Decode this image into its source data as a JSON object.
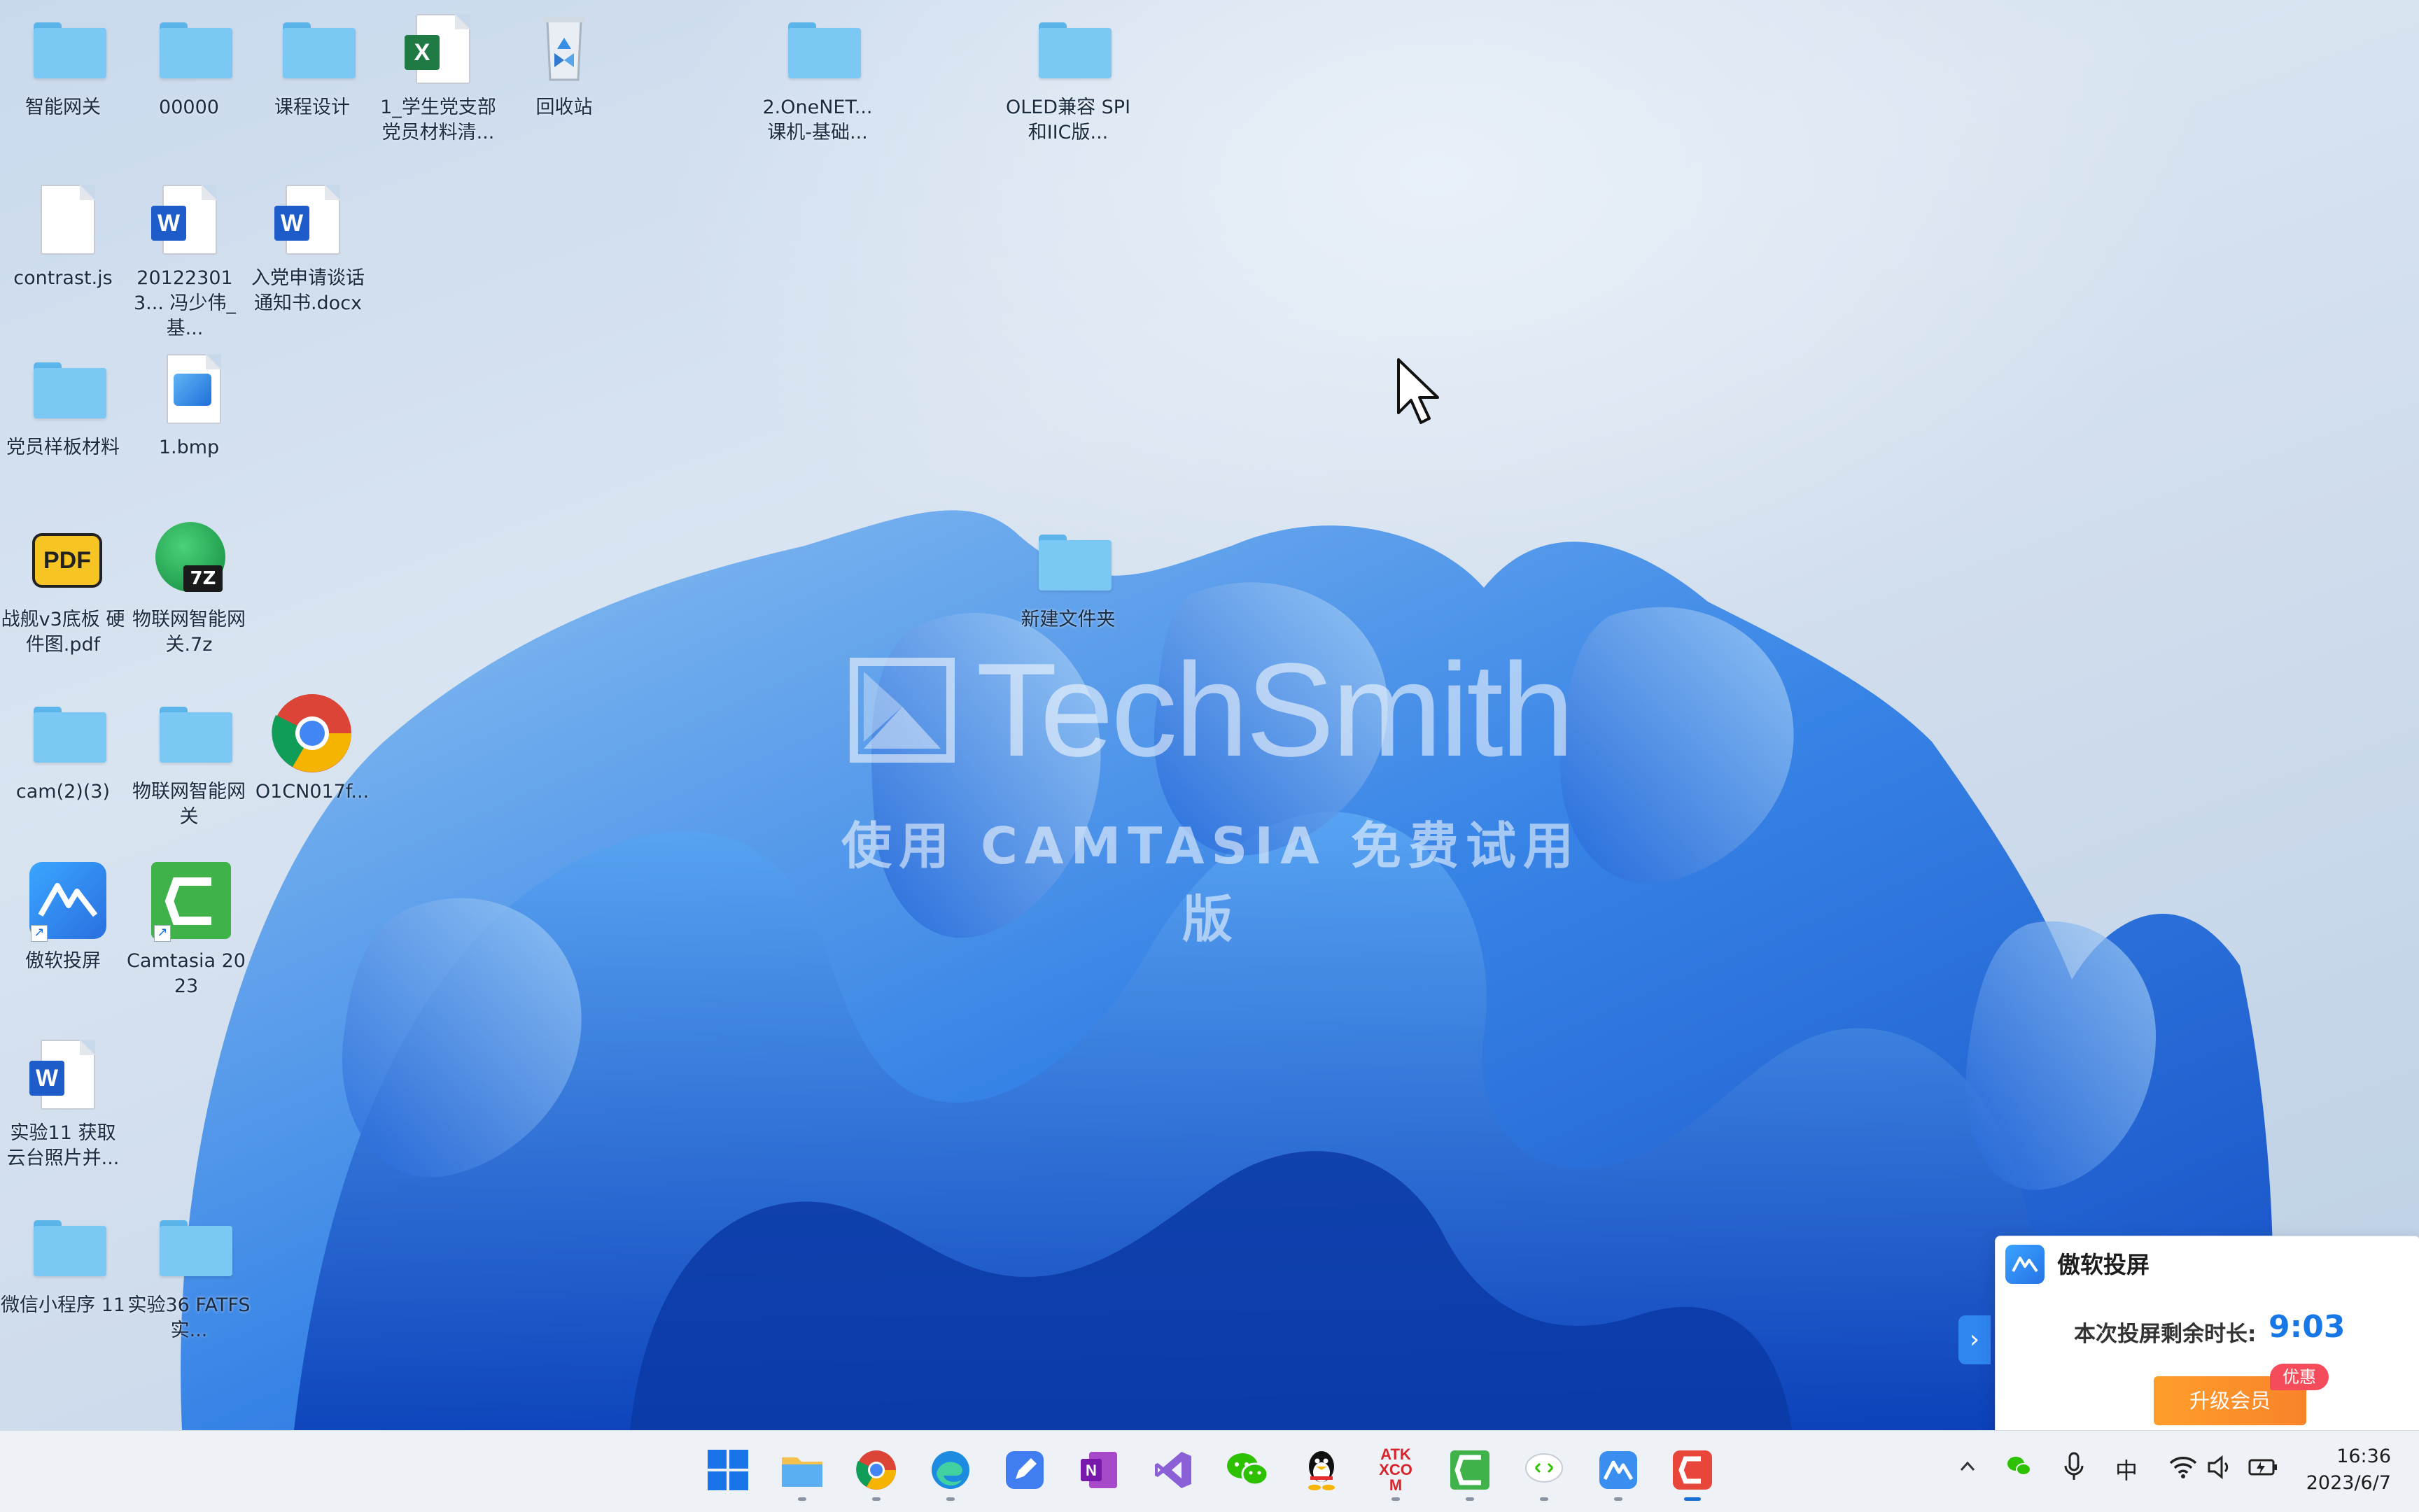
{
  "desktop": {
    "watermark": {
      "logo": "TechSmith",
      "subtitle": "使用 CAMTASIA 免费试用版"
    },
    "icons": [
      {
        "label": "智能网关",
        "type": "folder"
      },
      {
        "label": "00000",
        "type": "folder"
      },
      {
        "label": "课程设计",
        "type": "folder"
      },
      {
        "label": "1_学生党支部 党员材料清...",
        "type": "excel"
      },
      {
        "label": "回收站",
        "type": "recycle"
      },
      {
        "label": "2.OneNET... 课机-基础...",
        "type": "folder"
      },
      {
        "label": "OLED兼容 SPI和IIC版...",
        "type": "folder"
      },
      {
        "label": "contrast.js",
        "type": "file"
      },
      {
        "label": "201223013... 冯少伟_基...",
        "type": "word"
      },
      {
        "label": "入党申请谈话 通知书.docx",
        "type": "word"
      },
      {
        "label": "党员样板材料",
        "type": "folder"
      },
      {
        "label": "1.bmp",
        "type": "image"
      },
      {
        "label": "战舰v3底板 硬件图.pdf",
        "type": "pdf"
      },
      {
        "label": "物联网智能网 关.7z",
        "type": "7z"
      },
      {
        "label": "新建文件夹",
        "type": "folder"
      },
      {
        "label": "cam(2)(3)",
        "type": "folder"
      },
      {
        "label": "物联网智能网 关",
        "type": "folder"
      },
      {
        "label": "O1CN017f...",
        "type": "chrome"
      },
      {
        "label": "傲软投屏",
        "type": "apowermirror"
      },
      {
        "label": "Camtasia 2023",
        "type": "camtasia"
      },
      {
        "label": "实验11 获取 云台照片并...",
        "type": "word"
      },
      {
        "label": "微信小程序 11",
        "type": "folder"
      },
      {
        "label": "实验36 FATFS实...",
        "type": "folder"
      }
    ]
  },
  "popup": {
    "title": "傲软投屏",
    "remaining_label": "本次投屏剩余时长:",
    "remaining_time": "9:03",
    "upgrade_button": "升级会员",
    "promo_badge": "优惠"
  },
  "taskbar": {
    "apps": [
      {
        "name": "start",
        "icon": "windows-logo-icon"
      },
      {
        "name": "file-explorer",
        "icon": "folder-icon"
      },
      {
        "name": "chrome",
        "icon": "chrome-icon"
      },
      {
        "name": "edge",
        "icon": "edge-icon"
      },
      {
        "name": "notes",
        "icon": "pen-icon"
      },
      {
        "name": "onenote",
        "icon": "onenote-icon"
      },
      {
        "name": "visual-studio",
        "icon": "visual-studio-icon"
      },
      {
        "name": "wechat",
        "icon": "wechat-icon"
      },
      {
        "name": "qq",
        "icon": "qq-penguin-icon"
      },
      {
        "name": "atk-xcom",
        "icon": "atk-xcom-icon",
        "text": "ATK XCOM"
      },
      {
        "name": "camtasia",
        "icon": "camtasia-icon"
      },
      {
        "name": "wechat-devtools",
        "icon": "wechat-devtools-icon"
      },
      {
        "name": "apowermirror",
        "icon": "apowermirror-icon"
      },
      {
        "name": "camtasia-recorder",
        "icon": "recorder-icon"
      }
    ],
    "tray": {
      "ime": "中",
      "time": "16:36",
      "date": "2023/6/7"
    }
  }
}
